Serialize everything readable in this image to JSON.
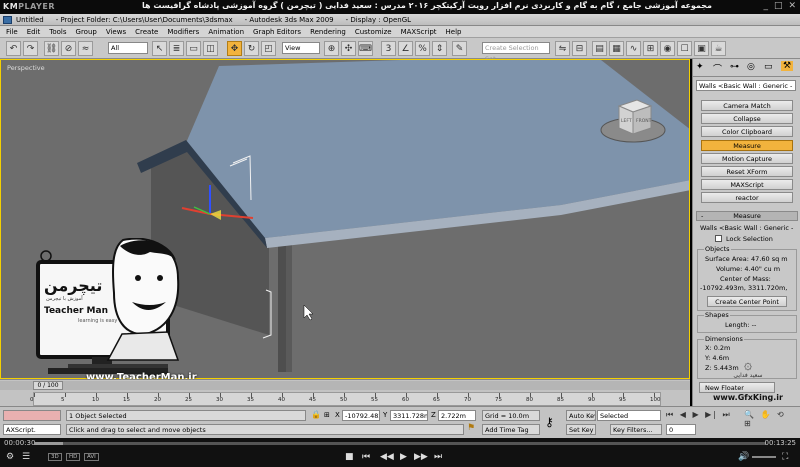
{
  "player": {
    "logo_km": "KM",
    "logo_player": "PLAYER",
    "course_title": "مجموعه آموزشی جامع ، گام به گام و کاربردی نرم افزار رویت آرکیتکچر ۲۰۱۶ مدرس : سعید فدایی ( تیچرمن ) گروه آموزشی پادشاه گرافیست ها",
    "time_elapsed": "00:00:30",
    "time_total": "00:13:25",
    "progress_fraction": 0.04,
    "badges": [
      "3D",
      "HD",
      "AVI"
    ],
    "win_min": "_",
    "win_max": "□",
    "win_close": "✕"
  },
  "app": {
    "title_doc": "Untitled",
    "title_folder": "- Project Folder: C:\\Users\\User\\Documents\\3dsmax",
    "title_app": "- Autodesk 3ds Max  2009",
    "title_display": "- Display : OpenGL"
  },
  "menu": [
    "File",
    "Edit",
    "Tools",
    "Group",
    "Views",
    "Create",
    "Modifiers",
    "Animation",
    "Graph Editors",
    "Rendering",
    "Customize",
    "MAXScript",
    "Help"
  ],
  "toolbar": {
    "filter": "All",
    "ref_coord": "View",
    "selection_set_placeholder": "Create Selection Set"
  },
  "viewport": {
    "label": "Perspective",
    "viewcube_left": "LEFT",
    "viewcube_front": "FRONT"
  },
  "command_panel": {
    "object_name": "Walls <Basic Wall : Generic -",
    "utilities": [
      "Camera Match",
      "Collapse",
      "Color Clipboard",
      "Measure",
      "Motion Capture",
      "Reset XForm",
      "MAXScript",
      "reactor"
    ],
    "rollout": "Measure",
    "rollout_sign": "-",
    "selected_name": "Walls <Basic Wall : Generic -",
    "lock_selection": "Lock Selection",
    "objects_title": "Objects",
    "surface_area": "Surface Area:  47.60 sq m",
    "volume": "Volume:  4.40\" cu m",
    "center_of_mass": "Center of Mass:",
    "com_value": "-10792.493m, 3311.720m,",
    "create_center_point": "Create Center Point",
    "shapes_title": "Shapes",
    "length": "Length:  --",
    "dimensions_title": "Dimensions",
    "dim_x": "X:  0.2m",
    "dim_y": "Y:  4.6m",
    "dim_z": "Z:  5.443m",
    "new_floater": "New Floater"
  },
  "timeline": {
    "frame": "0 / 100",
    "ticks": [
      "0",
      "5",
      "10",
      "15",
      "20",
      "25",
      "30",
      "35",
      "40",
      "45",
      "50",
      "55",
      "60",
      "65",
      "70",
      "75",
      "80",
      "85",
      "90",
      "95",
      "100"
    ]
  },
  "status": {
    "maxscript": "AXScript.",
    "selected": "1 Object Selected",
    "prompt": "Click and drag to select and move objects",
    "x": "-10792.482",
    "y": "3311.728m",
    "z": "2.722m",
    "grid": "Grid = 10.0m",
    "add_time_tag": "Add Time Tag",
    "auto_key": "Auto Key",
    "auto_key_mode": "Selected",
    "set_key": "Set Key",
    "key_filters": "Key Filters...",
    "frame_value": "0"
  },
  "watermark": {
    "teacher_fa": "تیچرمن",
    "teacher_sub": "آموزش با تیچرمن",
    "teacher_en": "Teacher Man",
    "teacher_tag": "learning is easy",
    "teacher_url": "www.TeacherMan.ir",
    "gfx_fa": "سعید فدایی",
    "gfx_url": "www.GfxKing.ir"
  },
  "colors": {
    "viewport_bg": "#6d6d6d",
    "active_highlight": "#f2b33d",
    "roof": "#7e93ab",
    "wall": "#5e5e5e"
  }
}
